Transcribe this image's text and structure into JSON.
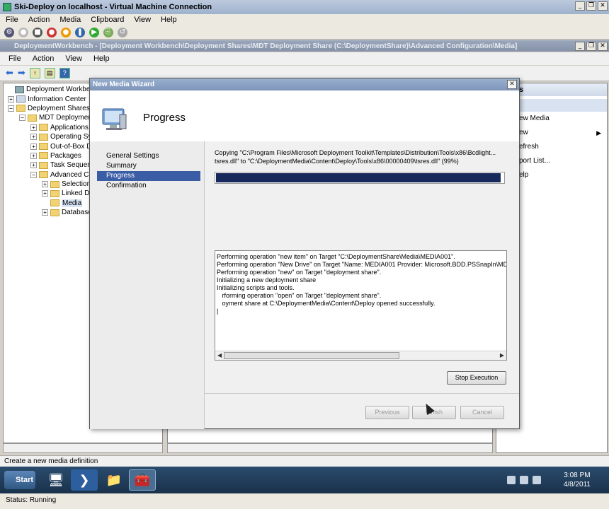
{
  "vm_window": {
    "title": "Ski-Deploy on localhost - Virtual Machine Connection",
    "menu": [
      "File",
      "Action",
      "Media",
      "Clipboard",
      "View",
      "Help"
    ],
    "status": "Status: Running"
  },
  "mmc_window": {
    "title": "DeploymentWorkbench - [Deployment Workbench\\Deployment Shares\\MDT Deployment Share (C:\\DeploymentShare)\\Advanced Configuration\\Media]",
    "menu": [
      "File",
      "Action",
      "View",
      "Help"
    ],
    "status": "Create a new media definition"
  },
  "tree": [
    {
      "label": "Deployment Workbench",
      "indent": 0,
      "exp": ""
    },
    {
      "label": "Information Center",
      "indent": 1,
      "exp": "+"
    },
    {
      "label": "Deployment Shares",
      "indent": 1,
      "exp": "−"
    },
    {
      "label": "MDT Deployment",
      "indent": 2,
      "exp": "−"
    },
    {
      "label": "Applications",
      "indent": 3,
      "exp": "+"
    },
    {
      "label": "Operating Sy",
      "indent": 3,
      "exp": "+"
    },
    {
      "label": "Out-of-Box D",
      "indent": 3,
      "exp": "+"
    },
    {
      "label": "Packages",
      "indent": 3,
      "exp": "+"
    },
    {
      "label": "Task Sequenc",
      "indent": 3,
      "exp": "+"
    },
    {
      "label": "Advanced Co",
      "indent": 3,
      "exp": "−"
    },
    {
      "label": "Selection",
      "indent": 4,
      "exp": "+"
    },
    {
      "label": "Linked De",
      "indent": 4,
      "exp": "+"
    },
    {
      "label": "Media",
      "indent": 4,
      "exp": ""
    },
    {
      "label": "Database",
      "indent": 4,
      "exp": "+"
    }
  ],
  "actions_pane": {
    "header": "s",
    "items": [
      "ew Media",
      "ew",
      "efresh",
      "port List...",
      "elp"
    ]
  },
  "wizard": {
    "title": "New Media Wizard",
    "heading": "Progress",
    "steps": [
      "General Settings",
      "Summary",
      "Progress",
      "Confirmation"
    ],
    "active_step": 2,
    "copying_line1": "Copying \"C:\\Program Files\\Microsoft Deployment Toolkit\\Templates\\Distribution\\Tools\\x86\\Bcdlight...",
    "copying_line2": "tsres.dll\" to \"C:\\DeploymentMedia\\Content\\Deploy\\Tools\\x86\\00000409\\tsres.dll\" (99%)",
    "progress_percent": 99,
    "log_lines": [
      "Performing operation \"new item\" on Target \"C:\\DeploymentShare\\Media\\MEDIA001\".",
      "Performing operation \"New Drive\" on Target \"Name: MEDIA001 Provider: Microsoft.BDD.PSSnapIn\\MD",
      "Performing operation \"new\" on Target \"deployment share\".",
      "Initializing a new deployment share",
      "Initializing scripts and tools.",
      "   rforming operation \"open\" on Target \"deployment share\".",
      "   oyment share at C:\\DeploymentMedia\\Content\\Deploy opened successfully.",
      "|"
    ],
    "stop_button": "Stop Execution",
    "previous_button": "Previous",
    "finish_button": "Finish",
    "cancel_button": "Cancel"
  },
  "taskbar": {
    "start_label": "Start",
    "time": "3:08 PM",
    "date": "4/8/2011"
  }
}
